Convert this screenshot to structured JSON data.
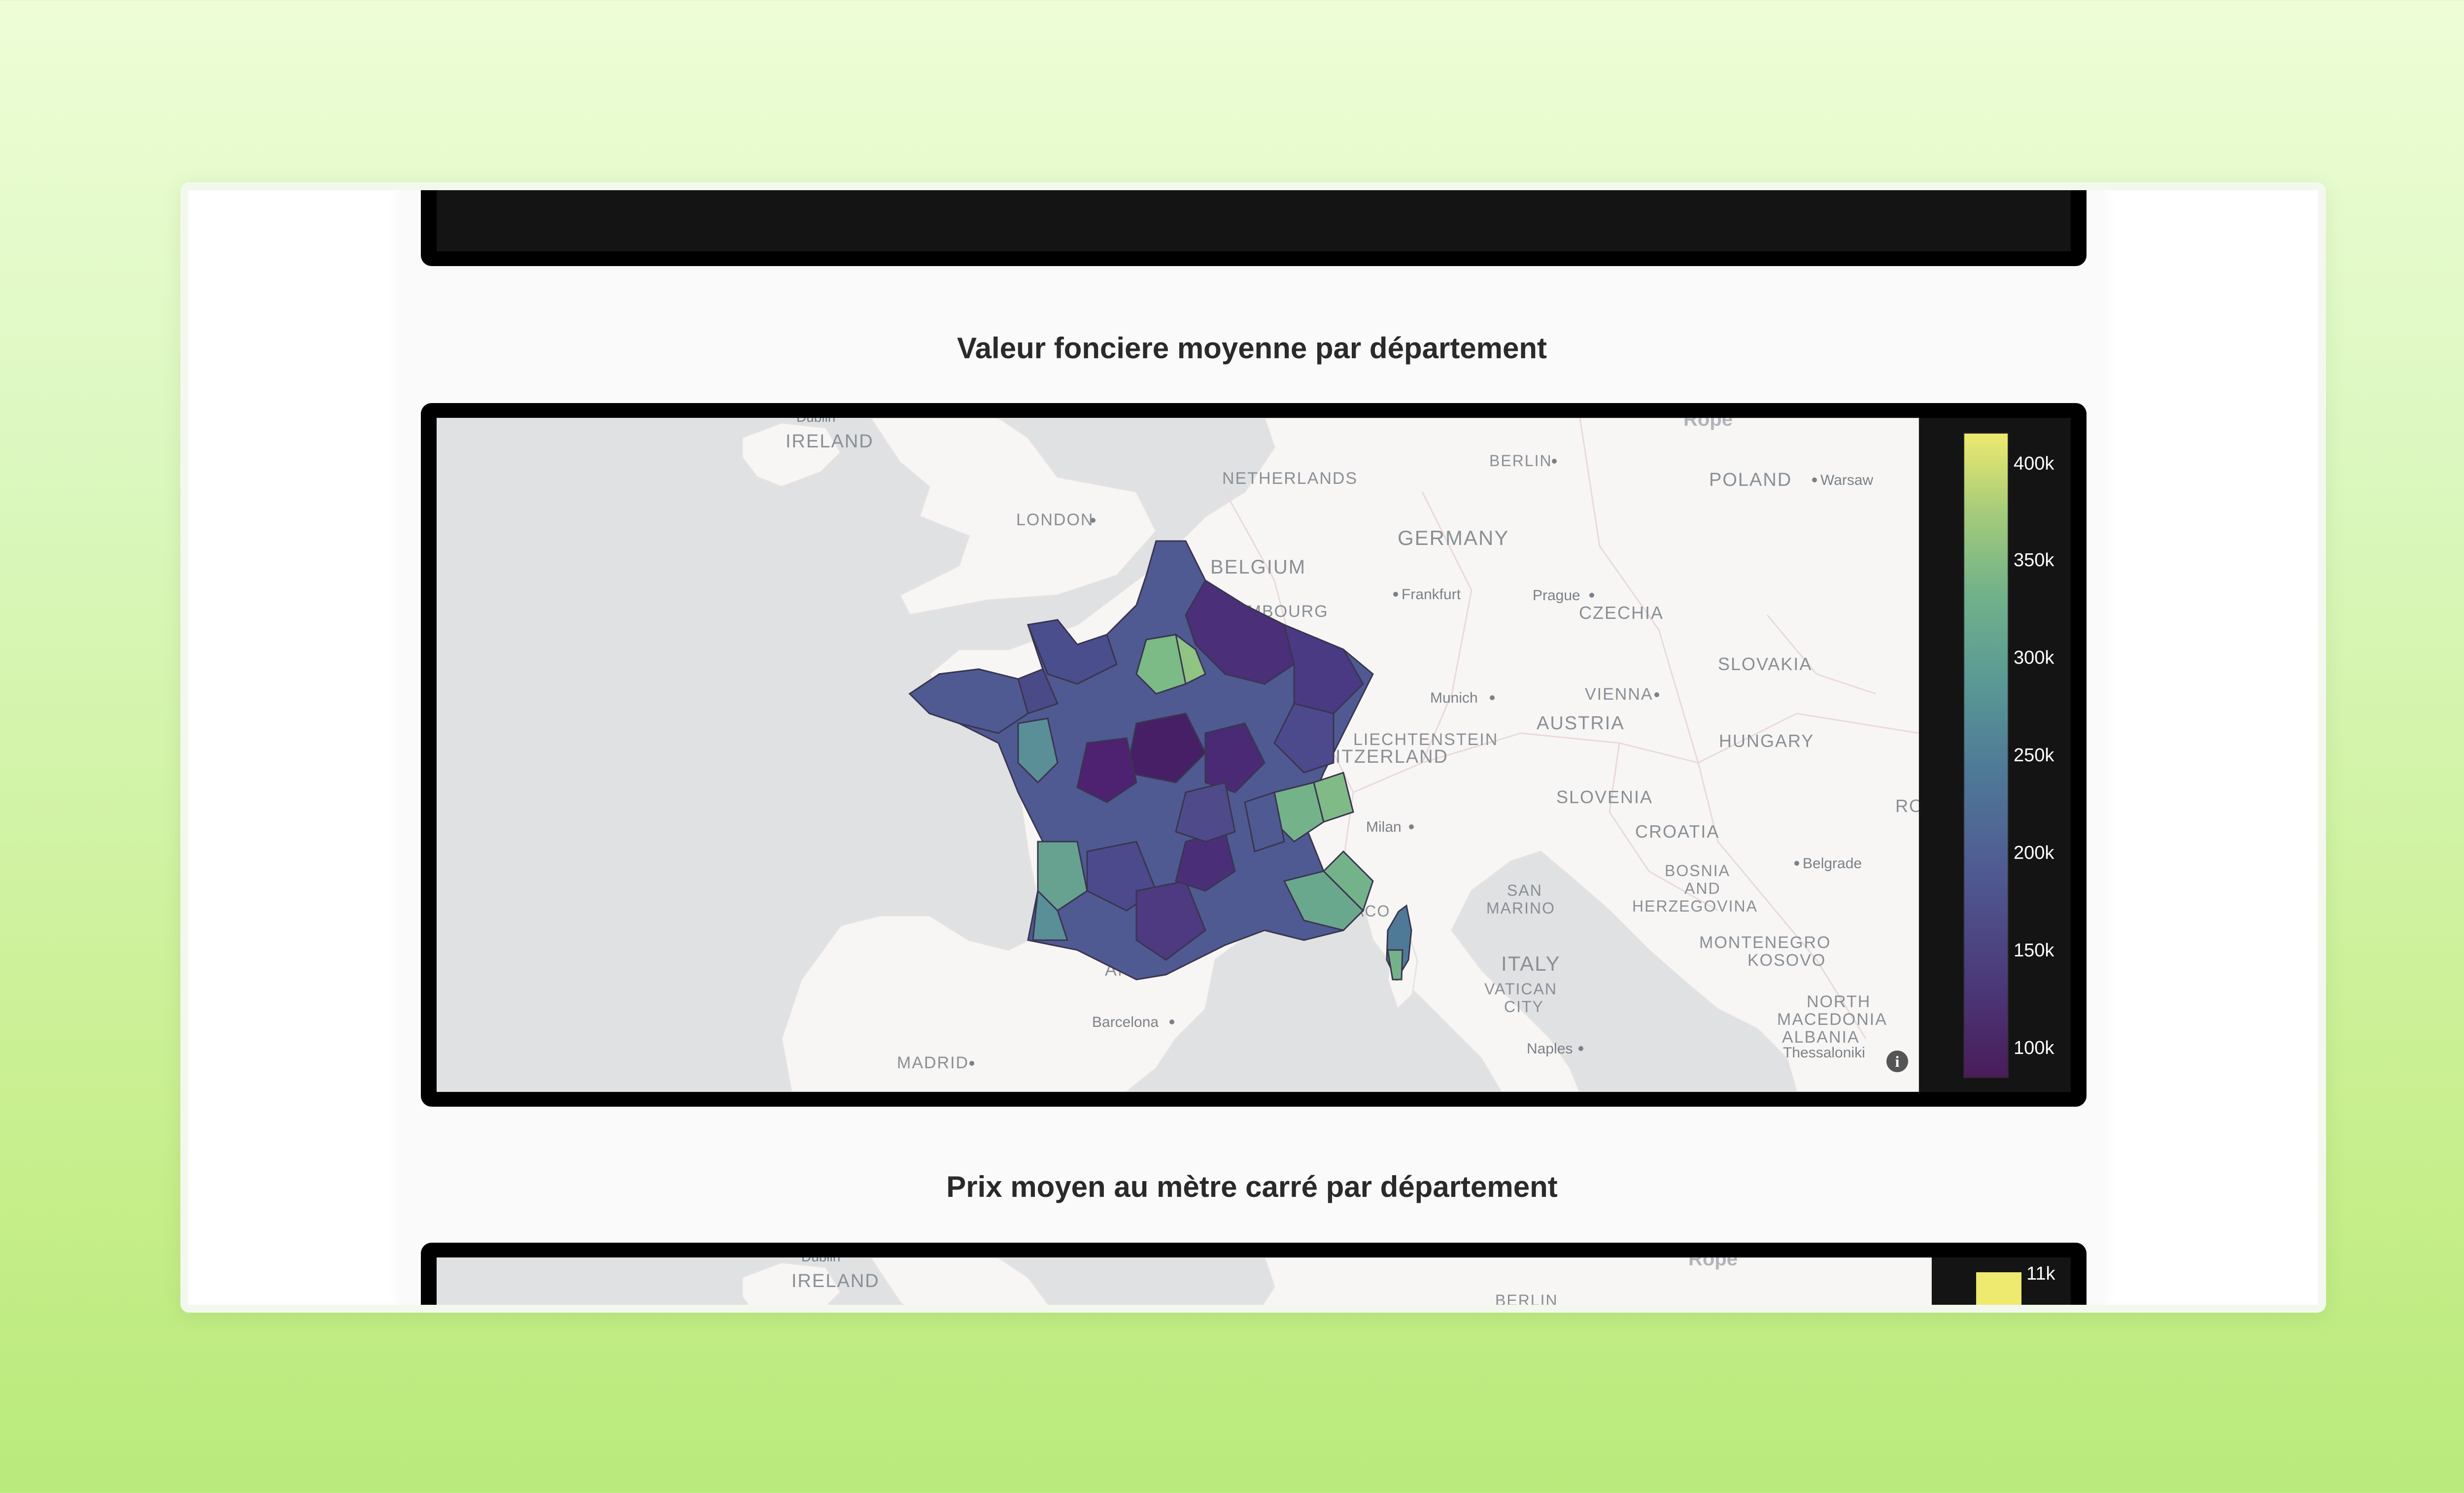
{
  "charts": {
    "map1": {
      "title": "Valeur fonciere moyenne par département",
      "colorbar": {
        "ticks": [
          "400k",
          "350k",
          "300k",
          "250k",
          "200k",
          "150k",
          "100k"
        ]
      },
      "labels": {
        "ireland": "IRELAND",
        "netherlands": "NETHERLANDS",
        "berlin": "BERLIN",
        "poland": "POLAND",
        "warsaw": "Warsaw",
        "london": "LONDON",
        "germany": "GERMANY",
        "belgium": "BELGIUM",
        "luxembourg": "EMBOURG",
        "frankfurt": "Frankfurt",
        "prague": "Prague",
        "czechia": "CZECHIA",
        "slovakia": "SLOVAKIA",
        "munich": "Munich",
        "vienna": "VIENNA",
        "liechtenstein": "LIECHTENSTEIN",
        "austria": "AUSTRIA",
        "hungary": "HUNGARY",
        "switzerland": "WITZERLAND",
        "slovenia": "SLOVENIA",
        "milan": "Milan",
        "croatia": "CROATIA",
        "belgrade": "Belgrade",
        "san_marino_1": "SAN",
        "san_marino_2": "MARINO",
        "bosnia_1": "BOSNIA",
        "bosnia_2": "AND",
        "bosnia_3": "HERZEGOVINA",
        "monaco": "ACO",
        "italy": "ITALY",
        "vatican_1": "VATICAN",
        "vatican_2": "CITY",
        "montenegro": "MONTENEGRO",
        "kosovo": "KOSOVO",
        "north_macedonia_1": "NORTH",
        "north_macedonia_2": "MACEDONIA",
        "albania": "ALBANIA",
        "andorra": "AND",
        "barcelona": "Barcelona",
        "madrid": "MADRID",
        "naples": "Naples",
        "thessaloniki": "Thessaloniki",
        "dublin": "Dublin",
        "europe_fragment": "Rope",
        "ro_fragment": "RO"
      }
    },
    "map2": {
      "title": "Prix moyen au mètre carré par département",
      "colorbar": {
        "ticks": [
          "11k"
        ]
      },
      "labels": {
        "ireland": "IRELAND",
        "berlin": "BERLIN",
        "dublin": "Dublin",
        "europe_fragment": "Rope"
      }
    }
  },
  "colors": {
    "page_bg_top": "#eefdd6",
    "page_bg_bottom": "#b9ea7c",
    "panel": "#000000",
    "colorbar_bg": "#141414",
    "sea": "#dfe1e3",
    "land": "#f7f6f4",
    "title_text": "#2a2a2a"
  }
}
